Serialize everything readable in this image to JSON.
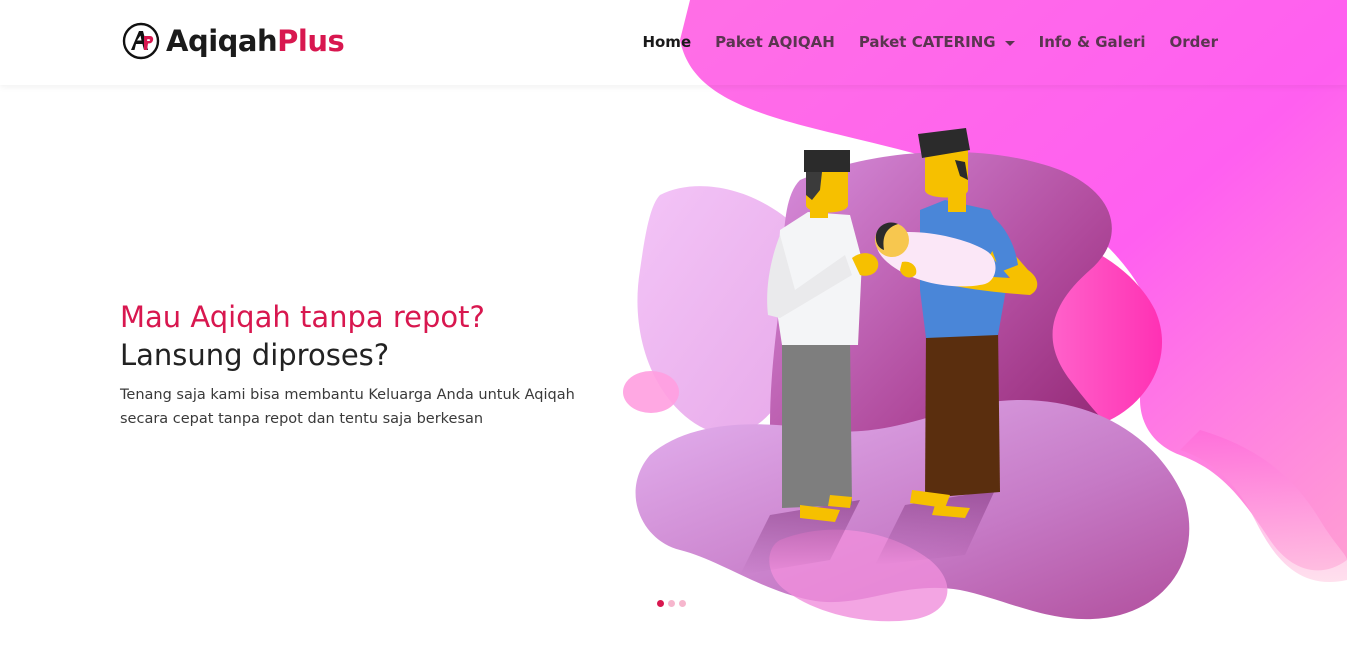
{
  "brand": {
    "name_part1": "Aqiqah",
    "name_part2": "Plus",
    "logo_icon": "ap-monogram-icon"
  },
  "nav": {
    "items": [
      {
        "label": "Home",
        "active": true
      },
      {
        "label": "Paket AQIQAH",
        "active": false
      },
      {
        "label": "Paket CATERING",
        "active": false,
        "dropdown": true
      },
      {
        "label": "Info & Galeri",
        "active": false
      },
      {
        "label": "Order",
        "active": false
      }
    ]
  },
  "hero": {
    "title": "Mau Aqiqah tanpa repot?",
    "subtitle": "Lansung diproses?",
    "description": "Tenang saja kami bisa membantu Keluarga Anda untuk Aqiqah secara cepat tanpa repot dan tentu saja berkesan",
    "illustration": "two-men-holding-baby-illustration"
  },
  "carousel": {
    "slides": 3,
    "active_index": 0
  },
  "colors": {
    "accent": "#d8174f",
    "blob_magenta": "#ff4ff3",
    "blob_purple": "#9c2a7c",
    "blob_lilac": "#e2b4f2",
    "nav_text": "#5a3550"
  }
}
